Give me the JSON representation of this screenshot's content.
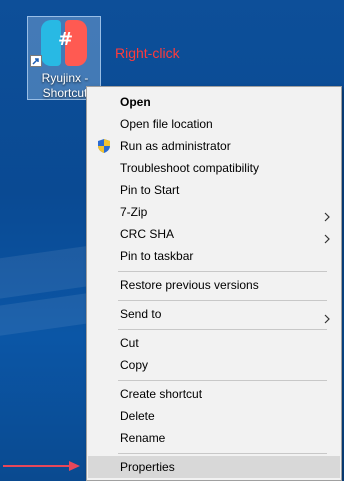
{
  "desktop": {
    "shortcut_label_line1": "Ryujinx -",
    "shortcut_label_line2": "Shortcut",
    "annotation": "Right-click",
    "annotation_color": "#ff3b3b"
  },
  "context_menu": {
    "items": {
      "open": "Open",
      "open_file_location": "Open file location",
      "run_as_admin": "Run as administrator",
      "troubleshoot": "Troubleshoot compatibility",
      "pin_to_start": "Pin to Start",
      "seven_zip": "7-Zip",
      "crc_sha": "CRC SHA",
      "pin_to_taskbar": "Pin to taskbar",
      "restore_previous": "Restore previous versions",
      "send_to": "Send to",
      "cut": "Cut",
      "copy": "Copy",
      "create_shortcut": "Create shortcut",
      "delete": "Delete",
      "rename": "Rename",
      "properties": "Properties"
    },
    "highlighted_item": "Properties",
    "icons": {
      "run_as_admin": "uac-shield-icon",
      "submenu": "chevron-right-icon"
    }
  },
  "colors": {
    "desktop_bg": "#0a4a93",
    "menu_bg": "#f2f2f2",
    "highlight": "#d8d8d8",
    "pointer_arrow": "#e8475a"
  }
}
